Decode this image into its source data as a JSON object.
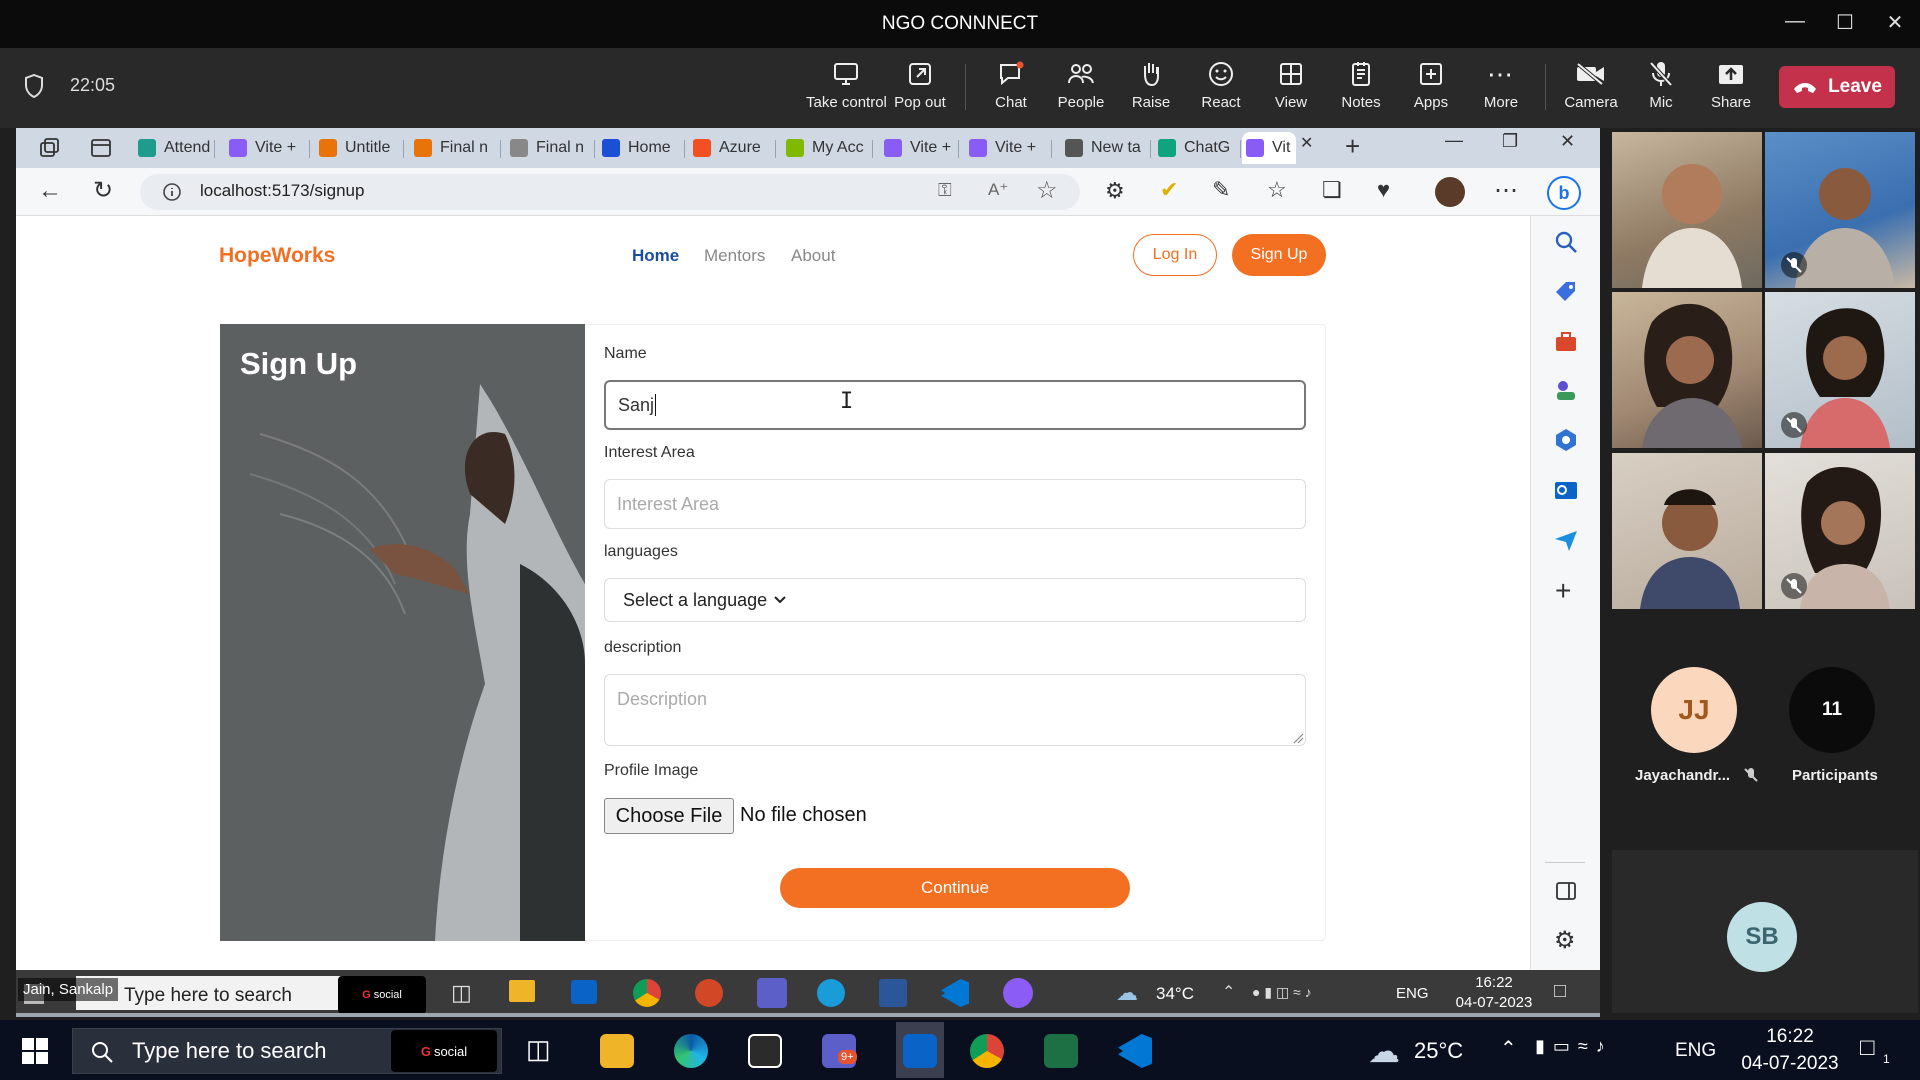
{
  "teams": {
    "window_title": "NGO CONNNECT",
    "timer": "22:05",
    "toolbar": {
      "take_control": "Take control",
      "pop_out": "Pop out",
      "chat": "Chat",
      "people": "People",
      "raise": "Raise",
      "react": "React",
      "view": "View",
      "notes": "Notes",
      "apps": "Apps",
      "more": "More",
      "camera": "Camera",
      "mic": "Mic",
      "share": "Share",
      "leave": "Leave"
    },
    "participants": {
      "avatar1_initials": "JJ",
      "avatar1_name": "Jayachandr...",
      "count": "11",
      "count_label": "Participants",
      "avatar2_initials": "SB"
    },
    "presenter_label": "Jain, Sankalp"
  },
  "browser": {
    "tabs": [
      {
        "label": "Attend",
        "color": "#1e9b8a"
      },
      {
        "label": "Vite +",
        "color": "#8a5cf6"
      },
      {
        "label": "Untitle",
        "color": "#e8730a"
      },
      {
        "label": "Final n",
        "color": "#e8730a"
      },
      {
        "label": "Final n",
        "color": "#888888"
      },
      {
        "label": "Home",
        "color": "#1a4fd6"
      },
      {
        "label": "Azure",
        "color": "#f25022"
      },
      {
        "label": "My Acc",
        "color": "#7fba00"
      },
      {
        "label": "Vite +",
        "color": "#8a5cf6"
      },
      {
        "label": "Vite +",
        "color": "#8a5cf6"
      },
      {
        "label": "New ta",
        "color": "#555555"
      },
      {
        "label": "ChatG",
        "color": "#10a37f"
      },
      {
        "label": "Vit",
        "color": "#8a5cf6"
      }
    ],
    "url": "localhost:5173/signup"
  },
  "page": {
    "brand": "HopeWorks",
    "nav": {
      "home": "Home",
      "mentors": "Mentors",
      "about": "About"
    },
    "login": "Log In",
    "signup": "Sign Up",
    "form_title": "Sign Up",
    "form": {
      "name_label": "Name",
      "name_value": "Sanj",
      "interest_label": "Interest Area",
      "interest_placeholder": "Interest Area",
      "languages_label": "languages",
      "languages_select": "Select a language",
      "description_label": "description",
      "description_placeholder": "Description",
      "profile_label": "Profile Image",
      "choose_file": "Choose File",
      "no_file": "No file chosen",
      "continue": "Continue"
    }
  },
  "inner_taskbar": {
    "search": "Type here to search",
    "social": "social",
    "temp": "34°C",
    "lang": "ENG",
    "time": "16:22",
    "date": "04-07-2023"
  },
  "taskbar": {
    "search": "Type here to search",
    "social": "social",
    "badge": "9+",
    "temp": "25°C",
    "lang": "ENG",
    "time": "16:22",
    "date": "04-07-2023",
    "notifications": "1"
  }
}
